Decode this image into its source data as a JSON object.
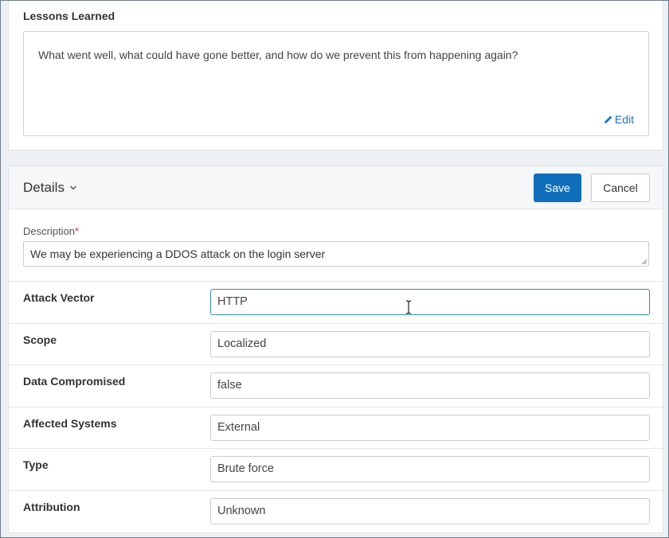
{
  "lessons": {
    "title": "Lessons Learned",
    "text": "What went well, what could have gone better, and how do we prevent this from happening again?",
    "edit_label": "Edit"
  },
  "details": {
    "title": "Details",
    "save_label": "Save",
    "cancel_label": "Cancel",
    "description_label": "Description",
    "description_required": "*",
    "description_value": "We may be experiencing a DDOS attack on the login server",
    "fields": [
      {
        "label": "Attack Vector",
        "value": "HTTP"
      },
      {
        "label": "Scope",
        "value": "Localized"
      },
      {
        "label": "Data Compromised",
        "value": "false"
      },
      {
        "label": "Affected Systems",
        "value": "External"
      },
      {
        "label": "Type",
        "value": "Brute force"
      },
      {
        "label": "Attribution",
        "value": "Unknown"
      }
    ]
  },
  "colors": {
    "primary": "#0f6fba",
    "link": "#1a74c4",
    "focus_border": "#2f8fa5"
  }
}
